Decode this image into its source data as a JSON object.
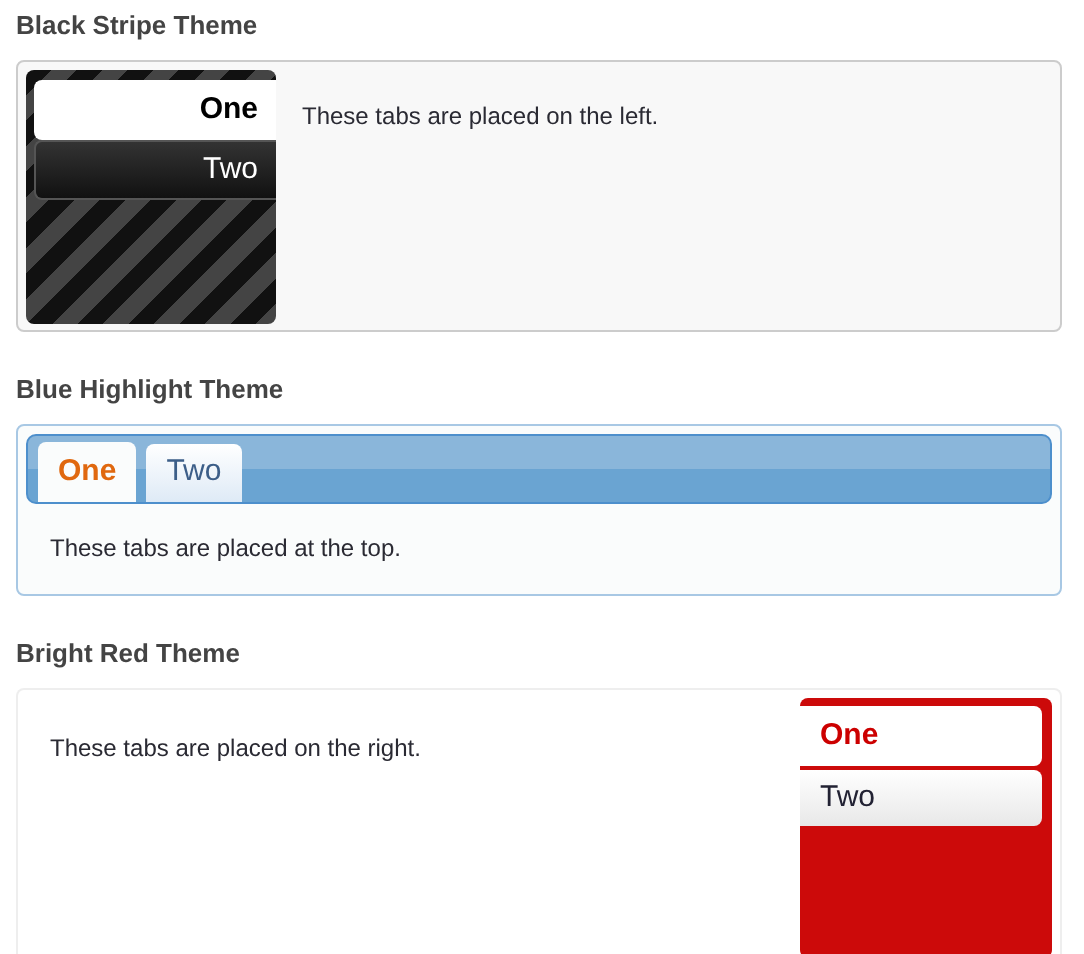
{
  "sections": [
    {
      "title": "Black Stripe Theme",
      "kind": "left",
      "tabs": [
        {
          "label": "One",
          "selected": true
        },
        {
          "label": "Two",
          "selected": false
        }
      ],
      "content": "These tabs are placed on the left."
    },
    {
      "title": "Blue Highlight Theme",
      "kind": "top",
      "tabs": [
        {
          "label": "One",
          "selected": true
        },
        {
          "label": "Two",
          "selected": false
        }
      ],
      "content": "These tabs are placed at the top."
    },
    {
      "title": "Bright Red Theme",
      "kind": "right",
      "tabs": [
        {
          "label": "One",
          "selected": true
        },
        {
          "label": "Two",
          "selected": false
        }
      ],
      "content": "These tabs are placed on the right."
    }
  ]
}
